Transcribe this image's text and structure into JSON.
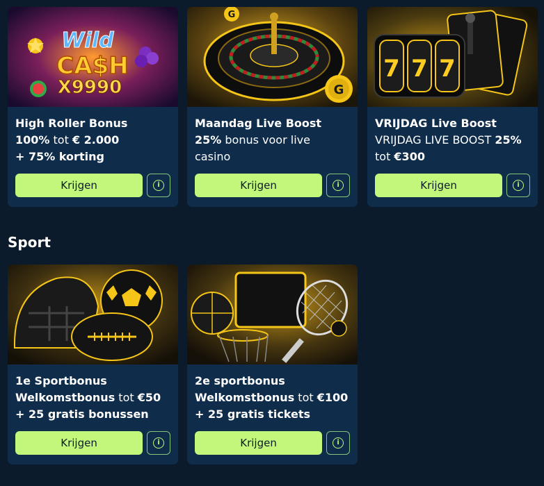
{
  "sections": [
    {
      "title": "",
      "cards": [
        {
          "image_label": "Wild Cash x9990",
          "title": "High Roller Bonus",
          "line1": [
            {
              "t": "100%",
              "b": true
            },
            {
              "t": " tot ",
              "b": false
            },
            {
              "t": "€ 2.000",
              "b": true
            }
          ],
          "line2": [
            {
              "t": "+ 75% korting",
              "b": true
            }
          ],
          "button_label": "Krijgen",
          "info_label": "i"
        },
        {
          "image_label": "Roulette",
          "title": "Maandag Live Boost",
          "line1": [
            {
              "t": "25%",
              "b": true
            },
            {
              "t": " bonus voor live",
              "b": false
            }
          ],
          "line2": [
            {
              "t": "casino",
              "b": false
            }
          ],
          "button_label": "Krijgen",
          "info_label": "i"
        },
        {
          "image_label": "777 Slot",
          "title": "VRIJDAG Live Boost",
          "line1": [
            {
              "t": "VRIJDAG LIVE BOOST ",
              "b": false
            },
            {
              "t": "25%",
              "b": true
            }
          ],
          "line2": [
            {
              "t": "tot ",
              "b": false
            },
            {
              "t": "€300",
              "b": true
            }
          ],
          "button_label": "Krijgen",
          "info_label": "i"
        }
      ]
    },
    {
      "title": "Sport",
      "cards": [
        {
          "image_label": "Sports balls",
          "title": "1e Sportbonus",
          "line1": [
            {
              "t": "Welkomstbonus",
              "b": true
            },
            {
              "t": " tot ",
              "b": false
            },
            {
              "t": "€50",
              "b": true
            }
          ],
          "line2": [
            {
              "t": "+ 25 gratis bonussen",
              "b": true
            }
          ],
          "button_label": "Krijgen",
          "info_label": "i"
        },
        {
          "image_label": "Basketball and tennis",
          "title": "2e sportbonus",
          "line1": [
            {
              "t": "Welkomstbonus",
              "b": true
            },
            {
              "t": " tot ",
              "b": false
            },
            {
              "t": "€100",
              "b": true
            }
          ],
          "line2": [
            {
              "t": "+ 25 gratis tickets",
              "b": true
            }
          ],
          "button_label": "Krijgen",
          "info_label": "i"
        }
      ]
    }
  ],
  "colors": {
    "background": "#0c1b2c",
    "card": "#0f2d4b",
    "accent": "#c3f77b",
    "gold": "#f5c518"
  }
}
